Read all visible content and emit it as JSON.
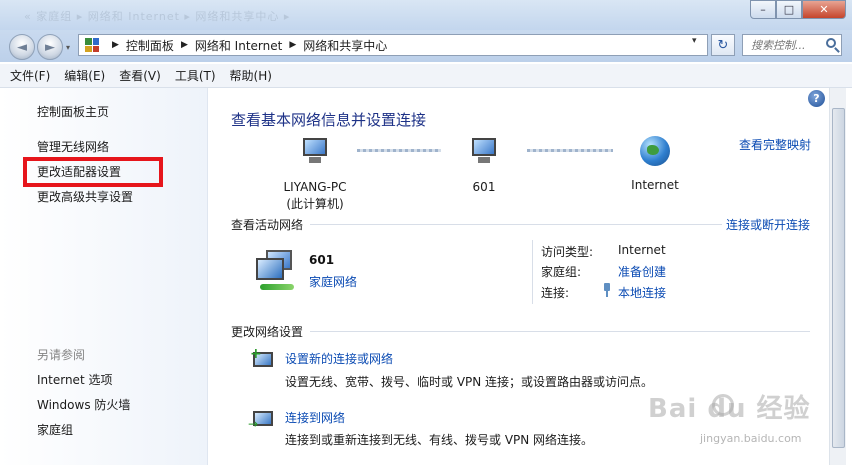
{
  "titlebar": {
    "ghost_text": "« 家庭组 ▸ 网络和 Internet ▸ 网络和共享中心 ▸",
    "minimize": "–",
    "maximize": "□",
    "close": "✕"
  },
  "nav": {
    "back": "◄",
    "forward": "►",
    "dropdown": "▾"
  },
  "address": {
    "crumbs": [
      "控制面板",
      "网络和 Internet",
      "网络和共享中心"
    ],
    "refresh": "↻",
    "search_placeholder": "搜索控制..."
  },
  "menubar": {
    "items": [
      "文件(F)",
      "编辑(E)",
      "查看(V)",
      "工具(T)",
      "帮助(H)"
    ]
  },
  "leftpane": {
    "home": "控制面板主页",
    "links": [
      "管理无线网络",
      "更改适配器设置",
      "更改高级共享设置"
    ],
    "see_also_title": "另请参阅",
    "see_also": [
      "Internet 选项",
      "Windows 防火墙",
      "家庭组"
    ]
  },
  "main": {
    "heading": "查看基本网络信息并设置连接",
    "full_map": "查看完整映射",
    "nodes": {
      "pc_name": "LIYANG-PC",
      "pc_sub": "(此计算机)",
      "network": "601",
      "internet": "Internet"
    },
    "active_title": "查看活动网络",
    "connect_disconnect": "连接或断开连接",
    "active": {
      "name": "601",
      "type": "家庭网络",
      "access_label": "访问类型:",
      "access_value": "Internet",
      "homegroup_label": "家庭组:",
      "homegroup_value": "准备创建",
      "connection_label": "连接:",
      "connection_value": "本地连接"
    },
    "change_title": "更改网络设置",
    "tasks": [
      {
        "link": "设置新的连接或网络",
        "desc": "设置无线、宽带、拨号、临时或 VPN 连接；或设置路由器或访问点。"
      },
      {
        "link": "连接到网络",
        "desc": "连接到或重新连接到无线、有线、拨号或 VPN 网络连接。"
      }
    ],
    "help": "?"
  },
  "watermark": {
    "brand": "Bai  du 经验",
    "sub": "jingyan.baidu.com"
  },
  "colors": {
    "link": "#0b4bb3",
    "heading": "#1e3287",
    "highlight": "#e6151b"
  }
}
